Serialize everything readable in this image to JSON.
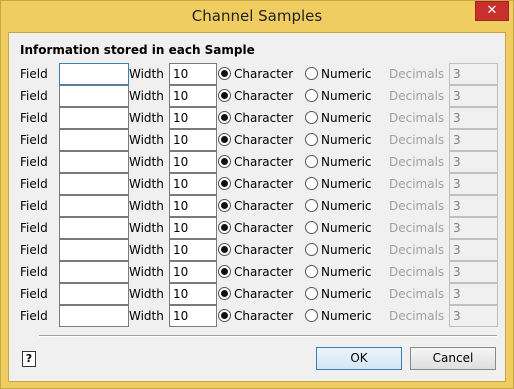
{
  "window": {
    "title": "Channel Samples",
    "close_label": "✕"
  },
  "section_title": "Information stored in each Sample",
  "labels": {
    "field": "Field",
    "width": "Width",
    "character": "Character",
    "numeric": "Numeric",
    "decimals": "Decimals"
  },
  "rows": [
    {
      "field_value": "",
      "width_value": "10",
      "type": "Character",
      "decimals_value": "3"
    },
    {
      "field_value": "",
      "width_value": "10",
      "type": "Character",
      "decimals_value": "3"
    },
    {
      "field_value": "",
      "width_value": "10",
      "type": "Character",
      "decimals_value": "3"
    },
    {
      "field_value": "",
      "width_value": "10",
      "type": "Character",
      "decimals_value": "3"
    },
    {
      "field_value": "",
      "width_value": "10",
      "type": "Character",
      "decimals_value": "3"
    },
    {
      "field_value": "",
      "width_value": "10",
      "type": "Character",
      "decimals_value": "3"
    },
    {
      "field_value": "",
      "width_value": "10",
      "type": "Character",
      "decimals_value": "3"
    },
    {
      "field_value": "",
      "width_value": "10",
      "type": "Character",
      "decimals_value": "3"
    },
    {
      "field_value": "",
      "width_value": "10",
      "type": "Character",
      "decimals_value": "3"
    },
    {
      "field_value": "",
      "width_value": "10",
      "type": "Character",
      "decimals_value": "3"
    },
    {
      "field_value": "",
      "width_value": "10",
      "type": "Character",
      "decimals_value": "3"
    },
    {
      "field_value": "",
      "width_value": "10",
      "type": "Character",
      "decimals_value": "3"
    }
  ],
  "buttons": {
    "ok": "OK",
    "cancel": "Cancel",
    "help_glyph": "?"
  },
  "icons": {
    "close": "close-icon",
    "help": "help-icon"
  },
  "colors": {
    "frame": "#f0cd61",
    "close": "#c7302b",
    "focus": "#3c7fb1"
  }
}
